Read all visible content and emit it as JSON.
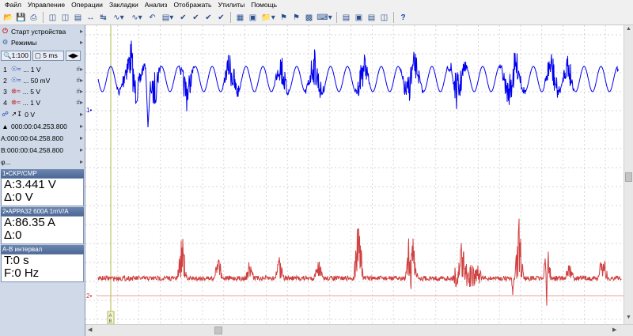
{
  "menu": [
    "Файл",
    "Управление",
    "Операции",
    "Закладки",
    "Анализ",
    "Отображать",
    "Утилиты",
    "Помощь"
  ],
  "left_panel": {
    "start_label": "Старт устройства",
    "modes_label": "Режимы",
    "zoom_value": "1:100",
    "timebase": "5 ms",
    "channels": [
      {
        "num": "1",
        "value": "... 1 V"
      },
      {
        "num": "2",
        "value": "... 50 mV"
      },
      {
        "num": "3",
        "value": "... 5 V"
      },
      {
        "num": "4",
        "value": "... 1 V"
      }
    ],
    "trigger_value": "0 V",
    "time_total": "000:00:04.253.800",
    "cursor_a_time": "A:000:00:04.258.800",
    "cursor_b_time": "B:000:00:04.258.800",
    "phi_label": "φ...",
    "panels": [
      {
        "title": "1•CKP/CMP",
        "line1": "A:3.441 V",
        "line2": "Δ:0 V"
      },
      {
        "title": "2•APPA32 600A 1mV/A",
        "line1": "A:86.35 A",
        "line2": "Δ:0"
      },
      {
        "title": "A-B интервал",
        "line1": "T:0 s",
        "line2": "F:0 Hz"
      }
    ]
  },
  "plot": {
    "channel1_marker": "1•",
    "channel2_marker": "2•",
    "cursor_marker_a": "A",
    "cursor_marker_b": "B",
    "colors": {
      "channel1": "#0000ee",
      "channel2": "#d04040",
      "grid": "#c8c8c8",
      "cursor": "#a8b040"
    }
  }
}
